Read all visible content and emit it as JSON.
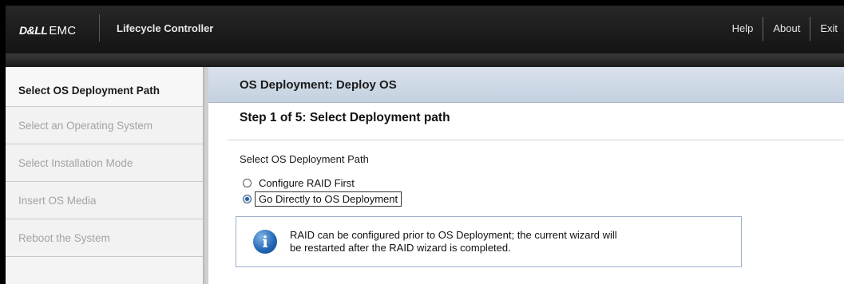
{
  "header": {
    "brand_dell": "D&LL",
    "brand_emc": "EMC",
    "app_title": "Lifecycle Controller",
    "nav": {
      "help": "Help",
      "about": "About",
      "exit": "Exit"
    }
  },
  "sidebar": {
    "items": [
      {
        "label": "Select OS Deployment Path",
        "active": true
      },
      {
        "label": "Select an Operating System",
        "active": false
      },
      {
        "label": "Select Installation Mode",
        "active": false
      },
      {
        "label": "Insert OS Media",
        "active": false
      },
      {
        "label": "Reboot the System",
        "active": false
      }
    ]
  },
  "main": {
    "header_title": "OS Deployment: Deploy OS",
    "step_title": "Step 1 of 5: Select Deployment path",
    "path_label": "Select OS Deployment Path",
    "options": [
      {
        "label": "Configure RAID First",
        "selected": false
      },
      {
        "label": "Go Directly to OS Deployment",
        "selected": true
      }
    ],
    "info": {
      "icon": "info-icon",
      "line1": "RAID can be configured prior to OS Deployment; the current wizard will",
      "line2": "be restarted after the RAID wizard is completed."
    }
  },
  "colors": {
    "header_bg": "#1c1c1c",
    "panel_header_bg": "#cfd9e6",
    "info_border": "#9cb0c8",
    "radio_selected": "#2f5da0"
  }
}
